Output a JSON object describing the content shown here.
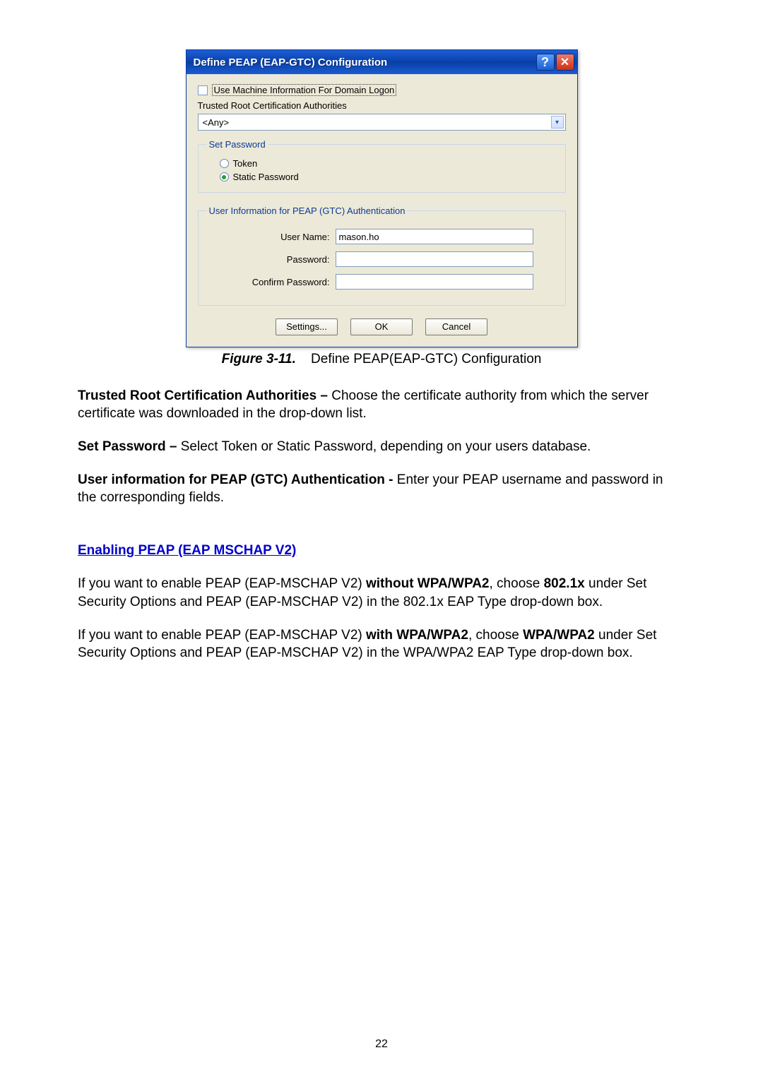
{
  "dialog": {
    "title": "Define PEAP (EAP-GTC) Configuration",
    "help_glyph": "?",
    "close_glyph": "✕",
    "checkbox_label": "Use Machine Information For Domain Logon",
    "trca_label": "Trusted Root Certification Authorities",
    "combo_value": "<Any>",
    "combo_arrow": "▾",
    "group_set_password": {
      "legend": "Set Password",
      "radio_token": "Token",
      "radio_static": "Static Password"
    },
    "group_user_info": {
      "legend": "User Information for PEAP (GTC) Authentication",
      "username_label": "User Name:",
      "username_value": "mason.ho",
      "password_label": "Password:",
      "confirm_label": "Confirm Password:"
    },
    "buttons": {
      "settings": "Settings...",
      "ok": "OK",
      "cancel": "Cancel"
    }
  },
  "figure": {
    "label": "Figure 3-11.",
    "desc": "Define PEAP(EAP-GTC) Configuration"
  },
  "para_trca_lead": "Trusted Root Certification Authorities – ",
  "para_trca_rest": "Choose the certificate authority from which the server certificate was downloaded in the drop-down list.",
  "para_setpw_lead": "Set Password – ",
  "para_setpw_rest": "Select Token or Static Password, depending on your users database.",
  "para_userinfo_lead": "User information for PEAP (GTC) Authentication - ",
  "para_userinfo_rest": "Enter your PEAP username and password in the corresponding fields.",
  "section_heading": "Enabling PEAP (EAP MSCHAP V2)",
  "para_nowpa_a": "If you want to enable PEAP (EAP-MSCHAP V2) ",
  "para_nowpa_b": "without WPA/WPA2",
  "para_nowpa_c": ", choose ",
  "para_nowpa_d": "802.1x",
  "para_nowpa_e": " under Set Security Options and PEAP (EAP-MSCHAP V2) in the 802.1x EAP Type drop-down box.",
  "para_wpa_a": "If you want to enable PEAP (EAP-MSCHAP V2) ",
  "para_wpa_b": "with WPA/WPA2",
  "para_wpa_c": ", choose ",
  "para_wpa_d": "WPA/WPA2",
  "para_wpa_e": " under Set Security Options and PEAP (EAP-MSCHAP V2) in the WPA/WPA2 EAP Type drop-down box.",
  "page_number": "22"
}
